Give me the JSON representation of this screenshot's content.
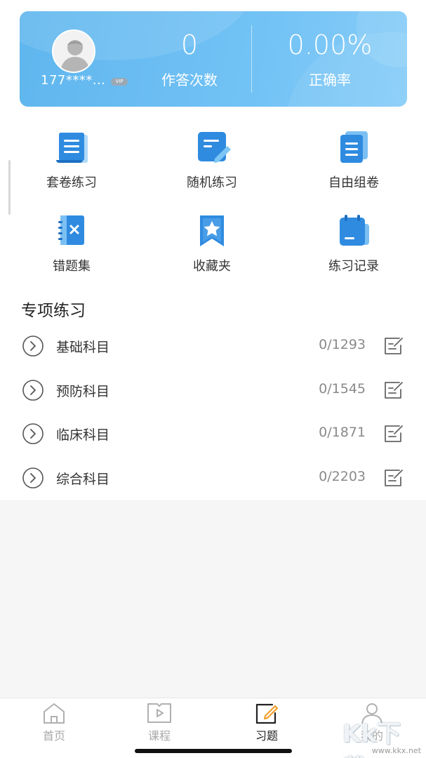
{
  "header": {
    "phone": "177****...",
    "vip": "VIP",
    "answers_count": "0",
    "answers_label": "作答次数",
    "accuracy_value": "0.00%",
    "accuracy_label": "正确率"
  },
  "grid": [
    {
      "label": "套卷练习",
      "icon": "scroll-document-icon"
    },
    {
      "label": "随机练习",
      "icon": "edit-document-icon"
    },
    {
      "label": "自由组卷",
      "icon": "stacked-documents-icon"
    },
    {
      "label": "错题集",
      "icon": "wrong-notebook-icon"
    },
    {
      "label": "收藏夹",
      "icon": "bookmark-star-icon"
    },
    {
      "label": "练习记录",
      "icon": "calendar-record-icon"
    }
  ],
  "section": {
    "title": "专项练习"
  },
  "subjects": [
    {
      "name": "基础科目",
      "count": "0/1293"
    },
    {
      "name": "预防科目",
      "count": "0/1545"
    },
    {
      "name": "临床科目",
      "count": "0/1871"
    },
    {
      "name": "综合科目",
      "count": "0/2203"
    }
  ],
  "tabs": [
    {
      "label": "首页",
      "icon": "home-icon"
    },
    {
      "label": "课程",
      "icon": "play-book-icon"
    },
    {
      "label": "习题",
      "icon": "pencil-note-icon"
    },
    {
      "label": "我的",
      "icon": "person-icon"
    }
  ],
  "active_tab": "习题",
  "watermark": {
    "logo": "Kk下载",
    "url": "www.kkx.net"
  },
  "colors": {
    "accent": "#3f9ee6",
    "card": "#6cbff3",
    "active_icon": "#f0a02a"
  }
}
